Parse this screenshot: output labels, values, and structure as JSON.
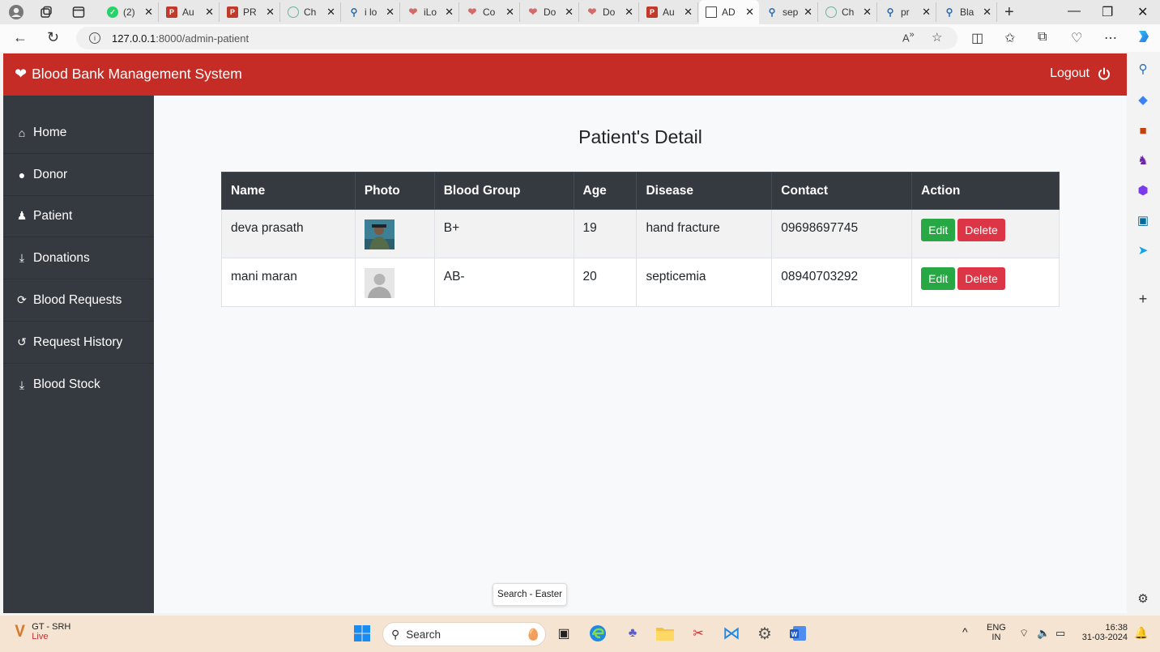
{
  "browser": {
    "tabs": [
      {
        "label": "(2)",
        "icon": "whatsapp-icon"
      },
      {
        "label": "Au",
        "icon": "pdf-icon"
      },
      {
        "label": "PR",
        "icon": "pdf-icon"
      },
      {
        "label": "Ch",
        "icon": "chatgpt-icon"
      },
      {
        "label": "i lo",
        "icon": "search-icon"
      },
      {
        "label": "iLo",
        "icon": "heart-icon"
      },
      {
        "label": "Co",
        "icon": "heart-icon"
      },
      {
        "label": "Do",
        "icon": "heart-icon"
      },
      {
        "label": "Do",
        "icon": "heart-icon"
      },
      {
        "label": "Au",
        "icon": "pdf-icon"
      },
      {
        "label": "AD",
        "icon": "document-icon",
        "active": true
      },
      {
        "label": "sep",
        "icon": "search-icon"
      },
      {
        "label": "Ch",
        "icon": "chatgpt-icon"
      },
      {
        "label": "pr",
        "icon": "search-icon"
      },
      {
        "label": "Bla",
        "icon": "search-icon"
      }
    ],
    "url_host": "127.0.0.1",
    "url_path": ":8000/admin-patient"
  },
  "app": {
    "brand": "Blood Bank Management System",
    "logout": "Logout"
  },
  "sidebar": {
    "items": [
      {
        "label": "Home",
        "icon": "home-icon"
      },
      {
        "label": "Donor",
        "icon": "user-icon"
      },
      {
        "label": "Patient",
        "icon": "patient-icon"
      },
      {
        "label": "Donations",
        "icon": "download-icon"
      },
      {
        "label": "Blood Requests",
        "icon": "refresh-icon"
      },
      {
        "label": "Request History",
        "icon": "history-icon"
      },
      {
        "label": "Blood Stock",
        "icon": "download-icon"
      }
    ]
  },
  "main": {
    "title": "Patient's Detail",
    "columns": [
      "Name",
      "Photo",
      "Blood Group",
      "Age",
      "Disease",
      "Contact",
      "Action"
    ],
    "rows": [
      {
        "name": "deva prasath",
        "blood_group": "B+",
        "age": "19",
        "disease": "hand fracture",
        "contact": "09698697745"
      },
      {
        "name": "mani maran",
        "blood_group": "AB-",
        "age": "20",
        "disease": "septicemia",
        "contact": "08940703292"
      }
    ],
    "edit_label": "Edit",
    "delete_label": "Delete"
  },
  "tooltip": "Search - Easter",
  "taskbar": {
    "weather_title": "GT - SRH",
    "weather_status": "Live",
    "search_label": "Search",
    "lang_top": "ENG",
    "lang_bottom": "IN",
    "time": "16:38",
    "date": "31-03-2024"
  },
  "colors": {
    "navbar": "#c52c25",
    "sidebar": "#343a40",
    "edit_button": "#28a745",
    "delete_button": "#dc3545"
  }
}
